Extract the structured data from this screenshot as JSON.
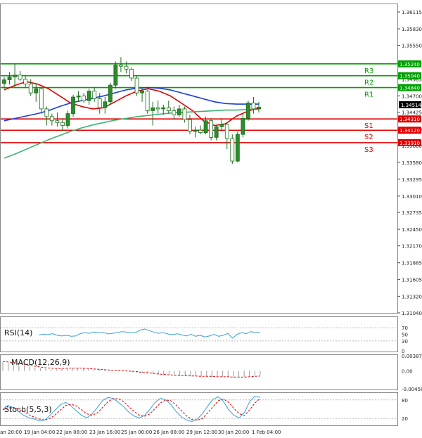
{
  "chart_data": [
    {
      "type": "candlestick",
      "price_axis": [
        "1.36115",
        "1.35830",
        "1.35550",
        "1.35265",
        "1.34985",
        "1.34700",
        "1.34425",
        "1.34140",
        "1.33860",
        "1.33580",
        "1.33295",
        "1.33010",
        "1.32735",
        "1.32450",
        "1.32170",
        "1.31885",
        "1.31605",
        "1.31320",
        "1.31040"
      ],
      "current_price": "1.34514",
      "ylim": [
        1.3104,
        1.36115
      ],
      "x_ticks": [
        "Jan 20:00",
        "19 Jan 04:00",
        "22 Jan 08:00",
        "23 Jan 16:00",
        "25 Jan 00:00",
        "26 Jan 08:00",
        "29 Jan 12:00",
        "30 Jan 20:00",
        "1 Feb 04:00"
      ],
      "levels": [
        {
          "label": "R3",
          "value": 1.3524,
          "value_text": "1.35240",
          "color": "#00a000"
        },
        {
          "label": "R2",
          "value": 1.3504,
          "value_text": "1.35040",
          "color": "#00a000"
        },
        {
          "label": "R1",
          "value": 1.3484,
          "value_text": "1.34840",
          "color": "#00a000"
        },
        {
          "label": "S1",
          "value": 1.3431,
          "value_text": "1.34310",
          "color": "#e00000"
        },
        {
          "label": "S2",
          "value": 1.3412,
          "value_text": "1.34120",
          "color": "#e00000"
        },
        {
          "label": "S3",
          "value": 1.3391,
          "value_text": "1.33910",
          "color": "#e00000"
        }
      ],
      "candles": [
        {
          "o": 1.3491,
          "h": 1.3502,
          "l": 1.3482,
          "c": 1.3497
        },
        {
          "o": 1.3497,
          "h": 1.351,
          "l": 1.3489,
          "c": 1.3502
        },
        {
          "o": 1.3502,
          "h": 1.3525,
          "l": 1.3485,
          "c": 1.3505
        },
        {
          "o": 1.3505,
          "h": 1.3512,
          "l": 1.3495,
          "c": 1.3498
        },
        {
          "o": 1.3498,
          "h": 1.3505,
          "l": 1.3485,
          "c": 1.349
        },
        {
          "o": 1.349,
          "h": 1.3498,
          "l": 1.347,
          "c": 1.3475
        },
        {
          "o": 1.3475,
          "h": 1.349,
          "l": 1.346,
          "c": 1.3482
        },
        {
          "o": 1.3482,
          "h": 1.3485,
          "l": 1.344,
          "c": 1.3448
        },
        {
          "o": 1.3448,
          "h": 1.3452,
          "l": 1.342,
          "c": 1.3435
        },
        {
          "o": 1.3435,
          "h": 1.344,
          "l": 1.342,
          "c": 1.3428
        },
        {
          "o": 1.3428,
          "h": 1.3442,
          "l": 1.3418,
          "c": 1.3425
        },
        {
          "o": 1.3425,
          "h": 1.3432,
          "l": 1.341,
          "c": 1.342
        },
        {
          "o": 1.342,
          "h": 1.3445,
          "l": 1.3415,
          "c": 1.344
        },
        {
          "o": 1.344,
          "h": 1.3472,
          "l": 1.3435,
          "c": 1.3468
        },
        {
          "o": 1.3468,
          "h": 1.3478,
          "l": 1.346,
          "c": 1.347
        },
        {
          "o": 1.347,
          "h": 1.3475,
          "l": 1.3458,
          "c": 1.3462
        },
        {
          "o": 1.3462,
          "h": 1.3482,
          "l": 1.3455,
          "c": 1.3478
        },
        {
          "o": 1.3478,
          "h": 1.3485,
          "l": 1.346,
          "c": 1.3465
        },
        {
          "o": 1.3465,
          "h": 1.3475,
          "l": 1.344,
          "c": 1.345
        },
        {
          "o": 1.345,
          "h": 1.3468,
          "l": 1.344,
          "c": 1.346
        },
        {
          "o": 1.346,
          "h": 1.3492,
          "l": 1.3455,
          "c": 1.3488
        },
        {
          "o": 1.3488,
          "h": 1.3528,
          "l": 1.3482,
          "c": 1.3522
        },
        {
          "o": 1.3522,
          "h": 1.3535,
          "l": 1.351,
          "c": 1.352
        },
        {
          "o": 1.352,
          "h": 1.3528,
          "l": 1.3508,
          "c": 1.3515
        },
        {
          "o": 1.3515,
          "h": 1.3518,
          "l": 1.3495,
          "c": 1.35
        },
        {
          "o": 1.35,
          "h": 1.3505,
          "l": 1.347,
          "c": 1.3475
        },
        {
          "o": 1.3475,
          "h": 1.3485,
          "l": 1.346,
          "c": 1.3478
        },
        {
          "o": 1.3478,
          "h": 1.348,
          "l": 1.344,
          "c": 1.3445
        },
        {
          "o": 1.3445,
          "h": 1.346,
          "l": 1.342,
          "c": 1.345
        },
        {
          "o": 1.345,
          "h": 1.3462,
          "l": 1.344,
          "c": 1.3448
        },
        {
          "o": 1.3448,
          "h": 1.3455,
          "l": 1.3438,
          "c": 1.345
        },
        {
          "o": 1.345,
          "h": 1.3462,
          "l": 1.344,
          "c": 1.3445
        },
        {
          "o": 1.3445,
          "h": 1.3452,
          "l": 1.343,
          "c": 1.3438
        },
        {
          "o": 1.3438,
          "h": 1.3455,
          "l": 1.3435,
          "c": 1.3448
        },
        {
          "o": 1.3448,
          "h": 1.3452,
          "l": 1.3425,
          "c": 1.343
        },
        {
          "o": 1.343,
          "h": 1.3438,
          "l": 1.3405,
          "c": 1.341
        },
        {
          "o": 1.341,
          "h": 1.3418,
          "l": 1.34,
          "c": 1.3412
        },
        {
          "o": 1.3412,
          "h": 1.342,
          "l": 1.3405,
          "c": 1.3408
        },
        {
          "o": 1.3408,
          "h": 1.3435,
          "l": 1.3405,
          "c": 1.3428
        },
        {
          "o": 1.3428,
          "h": 1.3432,
          "l": 1.3395,
          "c": 1.34
        },
        {
          "o": 1.34,
          "h": 1.342,
          "l": 1.3395,
          "c": 1.3418
        },
        {
          "o": 1.3418,
          "h": 1.343,
          "l": 1.341,
          "c": 1.3422
        },
        {
          "o": 1.3422,
          "h": 1.3425,
          "l": 1.338,
          "c": 1.3398
        },
        {
          "o": 1.3398,
          "h": 1.3405,
          "l": 1.3355,
          "c": 1.336
        },
        {
          "o": 1.336,
          "h": 1.341,
          "l": 1.3358,
          "c": 1.3405
        },
        {
          "o": 1.3405,
          "h": 1.344,
          "l": 1.34,
          "c": 1.3432
        },
        {
          "o": 1.3432,
          "h": 1.3462,
          "l": 1.3428,
          "c": 1.3458
        },
        {
          "o": 1.3458,
          "h": 1.3468,
          "l": 1.344,
          "c": 1.3448
        },
        {
          "o": 1.3448,
          "h": 1.346,
          "l": 1.3442,
          "c": 1.3451
        }
      ],
      "moving_averages": [
        {
          "color": "#e00000",
          "points": [
            1.348,
            1.3488,
            1.3494,
            1.349,
            1.3482,
            1.347,
            1.3458,
            1.3452,
            1.3448,
            1.345,
            1.346,
            1.347,
            1.3478,
            1.3482,
            1.3478,
            1.347,
            1.3458,
            1.3445,
            1.3428,
            1.342,
            1.3423,
            1.3436,
            1.3444,
            1.345
          ]
        },
        {
          "color": "#1a3cdd",
          "points": [
            1.3428,
            1.3432,
            1.3436,
            1.344,
            1.3445,
            1.3452,
            1.3458,
            1.3462,
            1.3466,
            1.347,
            1.3475,
            1.348,
            1.3483,
            1.3484,
            1.3483,
            1.348,
            1.3475,
            1.347,
            1.3465,
            1.346,
            1.3457,
            1.3456,
            1.3456,
            1.3456
          ]
        },
        {
          "color": "#3cb371",
          "points": [
            1.3365,
            1.3372,
            1.338,
            1.3388,
            1.3396,
            1.3403,
            1.341,
            1.3416,
            1.3421,
            1.3425,
            1.3429,
            1.3432,
            1.3435,
            1.3437,
            1.3439,
            1.3441,
            1.3442,
            1.3443,
            1.3444,
            1.3445,
            1.3446,
            1.3446,
            1.3447,
            1.3447
          ]
        }
      ]
    },
    {
      "type": "line",
      "title": "RSI(14)",
      "y_ticks": [
        "70",
        "50",
        "30",
        "0"
      ],
      "ylim": [
        0,
        100
      ],
      "values": [
        48,
        50,
        49,
        52,
        47,
        45,
        47,
        44,
        45,
        52,
        55,
        53,
        57,
        54,
        56,
        51,
        53,
        55,
        58,
        57,
        54,
        55,
        63,
        66,
        61,
        56,
        53,
        55,
        51,
        49,
        52,
        48,
        45,
        50,
        44,
        47,
        42,
        45,
        50,
        44,
        47,
        53,
        38,
        50,
        55,
        52,
        58,
        55,
        56
      ]
    },
    {
      "type": "bar",
      "title": "MACD(12,26,9)",
      "y_ticks": [
        "0.003876",
        "0.00",
        "-0.004583"
      ],
      "ylim": [
        -0.004583,
        0.003876
      ],
      "histogram": [
        0.0022,
        0.0021,
        0.0019,
        0.0017,
        0.0014,
        0.0011,
        0.0009,
        0.0007,
        0.0005,
        0.0004,
        0.0004,
        0.0005,
        0.0007,
        0.0008,
        0.0008,
        0.0007,
        0.0006,
        0.0005,
        0.0004,
        0.0003,
        0.0002,
        0.0001,
        0.0,
        -0.0001,
        -0.0002,
        -0.0004,
        -0.0005,
        -0.0007,
        -0.0008,
        -0.0009,
        -0.001,
        -0.0011,
        -0.0012,
        -0.0012,
        -0.0013,
        -0.0013,
        -0.0014,
        -0.0014,
        -0.0014,
        -0.0015,
        -0.0015,
        -0.0015,
        -0.0016,
        -0.0016,
        -0.0016,
        -0.0015,
        -0.0014,
        -0.0012,
        -0.001
      ],
      "signal": [
        0.0024,
        0.0023,
        0.0021,
        0.0019,
        0.0017,
        0.0014,
        0.0012,
        0.001,
        0.0008,
        0.0007,
        0.0006,
        0.0006,
        0.0007,
        0.0007,
        0.0007,
        0.0007,
        0.0006,
        0.0005,
        0.0004,
        0.0003,
        0.0002,
        0.0001,
        0.0001,
        0.0,
        -0.0001,
        -0.0002,
        -0.0004,
        -0.0005,
        -0.0006,
        -0.0008,
        -0.0009,
        -0.001,
        -0.0011,
        -0.0012,
        -0.0012,
        -0.0013,
        -0.0013,
        -0.0014,
        -0.0014,
        -0.0014,
        -0.0015,
        -0.0015,
        -0.0015,
        -0.0016,
        -0.0016,
        -0.0016,
        -0.0015,
        -0.0014,
        -0.0013
      ]
    },
    {
      "type": "line",
      "title": "Stoch(5,5,3)",
      "y_ticks": [
        "80",
        "20"
      ],
      "ylim": [
        0,
        100
      ],
      "series": [
        {
          "color": "#3aa0d8",
          "values": [
            50,
            62,
            55,
            42,
            30,
            22,
            18,
            12,
            15,
            30,
            48,
            65,
            72,
            60,
            45,
            30,
            22,
            35,
            55,
            78,
            88,
            85,
            72,
            58,
            40,
            28,
            22,
            30,
            50,
            72,
            85,
            80,
            65,
            42,
            25,
            15,
            10,
            18,
            35,
            60,
            82,
            90,
            75,
            48,
            30,
            22,
            40,
            75,
            92,
            88
          ]
        },
        {
          "color": "#e00000",
          "values": [
            48,
            55,
            56,
            50,
            42,
            32,
            24,
            18,
            15,
            20,
            32,
            48,
            62,
            66,
            60,
            48,
            35,
            30,
            38,
            56,
            74,
            84,
            84,
            74,
            58,
            42,
            30,
            27,
            35,
            52,
            70,
            80,
            77,
            63,
            45,
            28,
            17,
            14,
            20,
            38,
            58,
            77,
            83,
            72,
            52,
            35,
            30,
            48,
            70,
            85
          ]
        }
      ]
    }
  ]
}
